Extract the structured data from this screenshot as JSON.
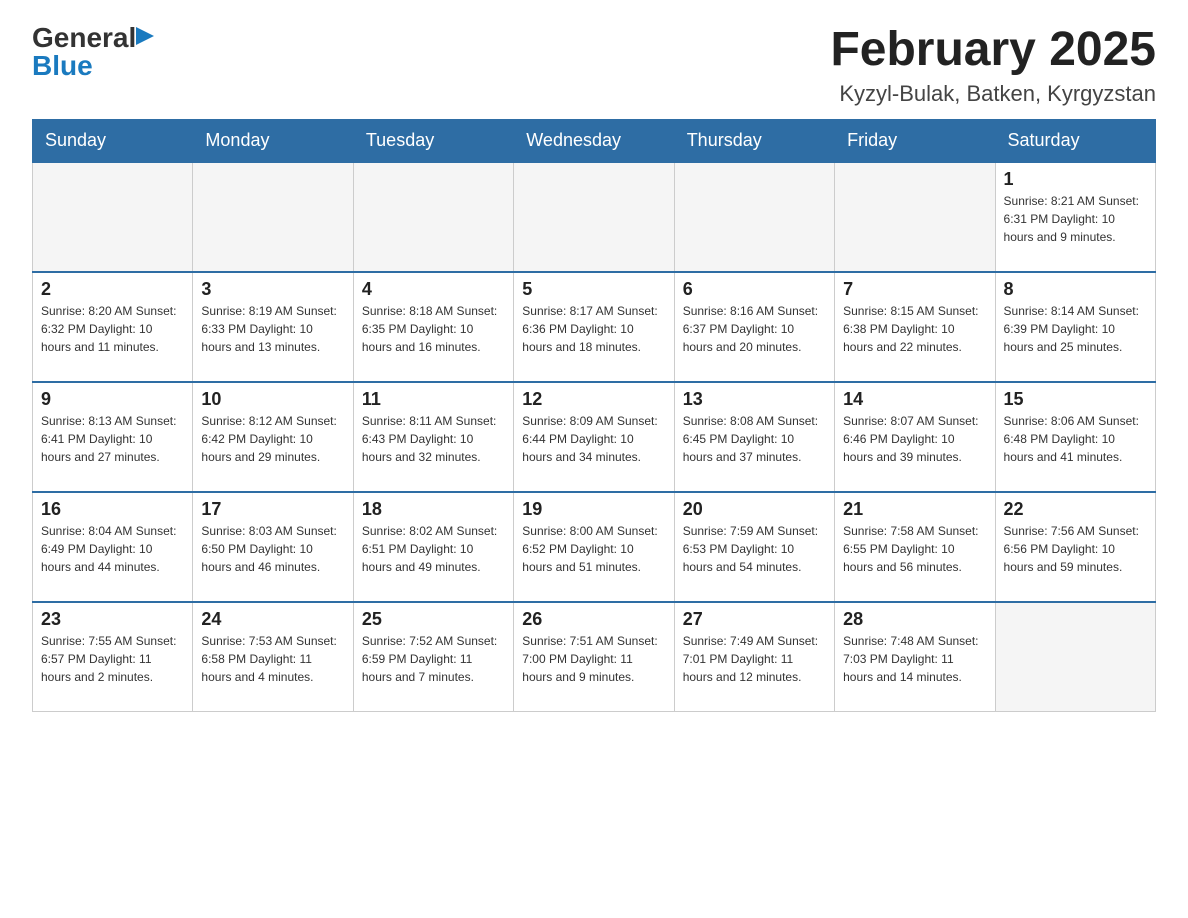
{
  "logo": {
    "general": "General",
    "blue": "Blue",
    "triangle": "▶"
  },
  "header": {
    "month_title": "February 2025",
    "location": "Kyzyl-Bulak, Batken, Kyrgyzstan"
  },
  "days_of_week": [
    "Sunday",
    "Monday",
    "Tuesday",
    "Wednesday",
    "Thursday",
    "Friday",
    "Saturday"
  ],
  "weeks": [
    {
      "days": [
        {
          "num": "",
          "info": "",
          "shaded": true
        },
        {
          "num": "",
          "info": "",
          "shaded": true
        },
        {
          "num": "",
          "info": "",
          "shaded": true
        },
        {
          "num": "",
          "info": "",
          "shaded": true
        },
        {
          "num": "",
          "info": "",
          "shaded": true
        },
        {
          "num": "",
          "info": "",
          "shaded": true
        },
        {
          "num": "1",
          "info": "Sunrise: 8:21 AM\nSunset: 6:31 PM\nDaylight: 10 hours and 9 minutes.",
          "shaded": false
        }
      ]
    },
    {
      "days": [
        {
          "num": "2",
          "info": "Sunrise: 8:20 AM\nSunset: 6:32 PM\nDaylight: 10 hours and 11 minutes.",
          "shaded": false
        },
        {
          "num": "3",
          "info": "Sunrise: 8:19 AM\nSunset: 6:33 PM\nDaylight: 10 hours and 13 minutes.",
          "shaded": false
        },
        {
          "num": "4",
          "info": "Sunrise: 8:18 AM\nSunset: 6:35 PM\nDaylight: 10 hours and 16 minutes.",
          "shaded": false
        },
        {
          "num": "5",
          "info": "Sunrise: 8:17 AM\nSunset: 6:36 PM\nDaylight: 10 hours and 18 minutes.",
          "shaded": false
        },
        {
          "num": "6",
          "info": "Sunrise: 8:16 AM\nSunset: 6:37 PM\nDaylight: 10 hours and 20 minutes.",
          "shaded": false
        },
        {
          "num": "7",
          "info": "Sunrise: 8:15 AM\nSunset: 6:38 PM\nDaylight: 10 hours and 22 minutes.",
          "shaded": false
        },
        {
          "num": "8",
          "info": "Sunrise: 8:14 AM\nSunset: 6:39 PM\nDaylight: 10 hours and 25 minutes.",
          "shaded": false
        }
      ]
    },
    {
      "days": [
        {
          "num": "9",
          "info": "Sunrise: 8:13 AM\nSunset: 6:41 PM\nDaylight: 10 hours and 27 minutes.",
          "shaded": false
        },
        {
          "num": "10",
          "info": "Sunrise: 8:12 AM\nSunset: 6:42 PM\nDaylight: 10 hours and 29 minutes.",
          "shaded": false
        },
        {
          "num": "11",
          "info": "Sunrise: 8:11 AM\nSunset: 6:43 PM\nDaylight: 10 hours and 32 minutes.",
          "shaded": false
        },
        {
          "num": "12",
          "info": "Sunrise: 8:09 AM\nSunset: 6:44 PM\nDaylight: 10 hours and 34 minutes.",
          "shaded": false
        },
        {
          "num": "13",
          "info": "Sunrise: 8:08 AM\nSunset: 6:45 PM\nDaylight: 10 hours and 37 minutes.",
          "shaded": false
        },
        {
          "num": "14",
          "info": "Sunrise: 8:07 AM\nSunset: 6:46 PM\nDaylight: 10 hours and 39 minutes.",
          "shaded": false
        },
        {
          "num": "15",
          "info": "Sunrise: 8:06 AM\nSunset: 6:48 PM\nDaylight: 10 hours and 41 minutes.",
          "shaded": false
        }
      ]
    },
    {
      "days": [
        {
          "num": "16",
          "info": "Sunrise: 8:04 AM\nSunset: 6:49 PM\nDaylight: 10 hours and 44 minutes.",
          "shaded": false
        },
        {
          "num": "17",
          "info": "Sunrise: 8:03 AM\nSunset: 6:50 PM\nDaylight: 10 hours and 46 minutes.",
          "shaded": false
        },
        {
          "num": "18",
          "info": "Sunrise: 8:02 AM\nSunset: 6:51 PM\nDaylight: 10 hours and 49 minutes.",
          "shaded": false
        },
        {
          "num": "19",
          "info": "Sunrise: 8:00 AM\nSunset: 6:52 PM\nDaylight: 10 hours and 51 minutes.",
          "shaded": false
        },
        {
          "num": "20",
          "info": "Sunrise: 7:59 AM\nSunset: 6:53 PM\nDaylight: 10 hours and 54 minutes.",
          "shaded": false
        },
        {
          "num": "21",
          "info": "Sunrise: 7:58 AM\nSunset: 6:55 PM\nDaylight: 10 hours and 56 minutes.",
          "shaded": false
        },
        {
          "num": "22",
          "info": "Sunrise: 7:56 AM\nSunset: 6:56 PM\nDaylight: 10 hours and 59 minutes.",
          "shaded": false
        }
      ]
    },
    {
      "days": [
        {
          "num": "23",
          "info": "Sunrise: 7:55 AM\nSunset: 6:57 PM\nDaylight: 11 hours and 2 minutes.",
          "shaded": false
        },
        {
          "num": "24",
          "info": "Sunrise: 7:53 AM\nSunset: 6:58 PM\nDaylight: 11 hours and 4 minutes.",
          "shaded": false
        },
        {
          "num": "25",
          "info": "Sunrise: 7:52 AM\nSunset: 6:59 PM\nDaylight: 11 hours and 7 minutes.",
          "shaded": false
        },
        {
          "num": "26",
          "info": "Sunrise: 7:51 AM\nSunset: 7:00 PM\nDaylight: 11 hours and 9 minutes.",
          "shaded": false
        },
        {
          "num": "27",
          "info": "Sunrise: 7:49 AM\nSunset: 7:01 PM\nDaylight: 11 hours and 12 minutes.",
          "shaded": false
        },
        {
          "num": "28",
          "info": "Sunrise: 7:48 AM\nSunset: 7:03 PM\nDaylight: 11 hours and 14 minutes.",
          "shaded": false
        },
        {
          "num": "",
          "info": "",
          "shaded": true
        }
      ]
    }
  ]
}
